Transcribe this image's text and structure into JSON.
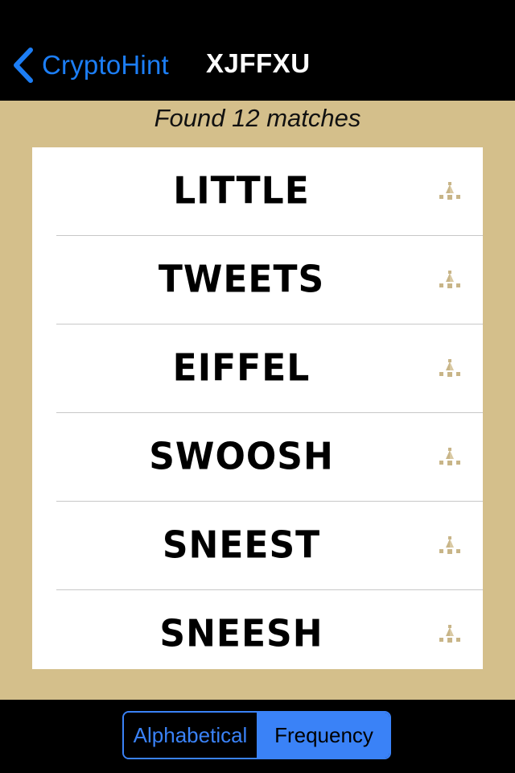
{
  "nav": {
    "back_label": "CryptoHint",
    "title": "XJFFXU"
  },
  "summary": {
    "match_text": "Found 12 matches"
  },
  "results": [
    {
      "word": "LITTLE",
      "icon": "boat-icon"
    },
    {
      "word": "TWEETS",
      "icon": "boat-icon"
    },
    {
      "word": "EIFFEL",
      "icon": "boat-icon"
    },
    {
      "word": "SWOOSH",
      "icon": "boat-icon"
    },
    {
      "word": "SNEEST",
      "icon": "boat-icon"
    },
    {
      "word": "SNEESH",
      "icon": "boat-icon"
    }
  ],
  "sort_control": {
    "options": [
      "Alphabetical",
      "Frequency"
    ],
    "selected": "Frequency"
  },
  "colors": {
    "accent": "#1c7ef6",
    "segment_blue": "#3a82f7",
    "background_tan": "#d4bf8b",
    "icon_tan": "#c8b588"
  }
}
